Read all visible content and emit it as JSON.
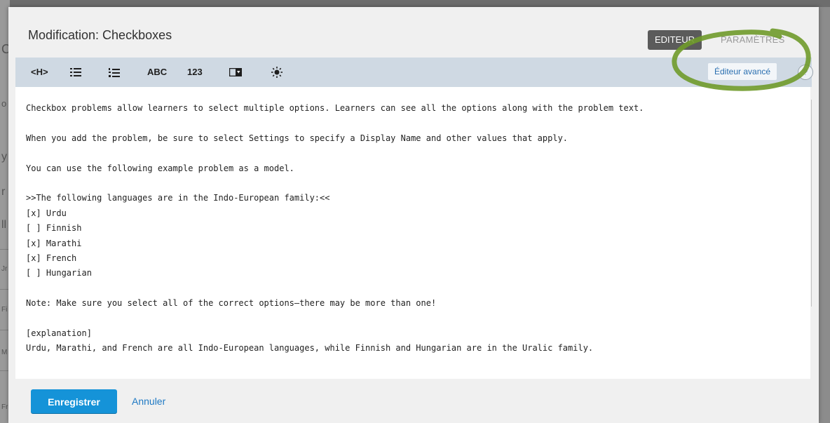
{
  "background": {
    "fragments": [
      "C",
      "o",
      "y",
      "r",
      "ll",
      "Jr",
      "Fi",
      "M",
      "Fr"
    ]
  },
  "modal": {
    "title": "Modification: Checkboxes",
    "modes": {
      "editor": "EDITEUR",
      "settings": "PARAMÈTRES"
    }
  },
  "toolbar": {
    "heading": "<H>",
    "bullet_icon": "bulleted-list-icon",
    "numbered_icon": "numbered-list-icon",
    "text_input": "ABC",
    "numeric_input": "123",
    "dropdown_icon": "dropdown-icon",
    "explanation_icon": "explanation-icon",
    "advanced_editor": "Éditeur avancé",
    "help": "?"
  },
  "editor": {
    "lines": [
      "Checkbox problems allow learners to select multiple options. Learners can see all the options along with the problem text.",
      "",
      "When you add the problem, be sure to select Settings to specify a Display Name and other values that apply.",
      "",
      "You can use the following example problem as a model.",
      "",
      ">>The following languages are in the Indo-European family:<<",
      "[x] Urdu",
      "[ ] Finnish",
      "[x] Marathi",
      "[x] French",
      "[ ] Hungarian",
      "",
      "Note: Make sure you select all of the correct options—there may be more than one!",
      "",
      "[explanation]",
      "Urdu, Marathi, and French are all Indo-European languages, while Finnish and Hungarian are in the Uralic family."
    ]
  },
  "footer": {
    "save": "Enregistrer",
    "cancel": "Annuler"
  },
  "colors": {
    "toolbar_bg": "#cfd9e3",
    "primary": "#1593d8",
    "link": "#1f7ac4",
    "annotation": "#6f9a2a"
  }
}
